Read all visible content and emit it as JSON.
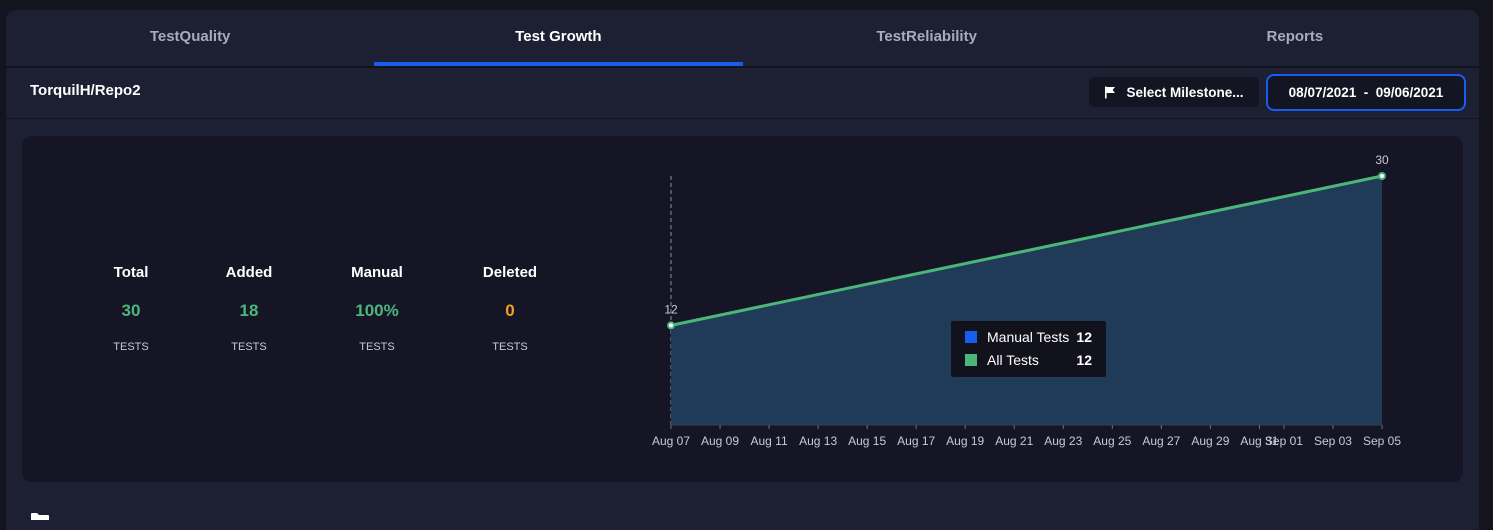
{
  "tabs": [
    {
      "label": "TestQuality"
    },
    {
      "label": "Test Growth"
    },
    {
      "label": "TestReliability"
    },
    {
      "label": "Reports"
    }
  ],
  "active_tab": "Test Growth",
  "header": {
    "repo": "TorquilH/Repo2",
    "milestone_button": "Select Milestone...",
    "date_range": "08/07/2021  -  09/06/2021",
    "flag_icon": "flag-icon"
  },
  "stats": {
    "total": {
      "label": "Total",
      "value": "30",
      "unit": "TESTS"
    },
    "added": {
      "label": "Added",
      "value": "18",
      "unit": "TESTS"
    },
    "manual": {
      "label": "Manual",
      "value": "100%",
      "unit": "TESTS"
    },
    "deleted": {
      "label": "Deleted",
      "value": "0",
      "unit": "TESTS"
    }
  },
  "colors": {
    "accent": "#1a5cf0",
    "green": "#4cb67a",
    "orange": "#f0a024",
    "area_fill": "#1f3b57"
  },
  "chart_data": {
    "type": "area",
    "x": [
      "Aug 07",
      "Sep 05"
    ],
    "xticks": [
      "Aug 07",
      "Aug 09",
      "Aug 11",
      "Aug 13",
      "Aug 15",
      "Aug 17",
      "Aug 19",
      "Aug 21",
      "Aug 23",
      "Aug 25",
      "Aug 27",
      "Aug 29",
      "Aug 31",
      "Sep 01",
      "Sep 03",
      "Sep 05"
    ],
    "series": [
      {
        "name": "All Tests",
        "values": [
          12,
          30
        ],
        "color": "#4cb67a"
      }
    ],
    "point_labels": [
      "12",
      "30"
    ],
    "tooltip": {
      "rows": [
        {
          "name": "Manual Tests",
          "value": "12",
          "color": "#1a5cf0"
        },
        {
          "name": "All Tests",
          "value": "12",
          "color": "#4cb67a"
        }
      ]
    },
    "grid": false
  },
  "footer": {
    "folder_icon": "folder-icon"
  }
}
